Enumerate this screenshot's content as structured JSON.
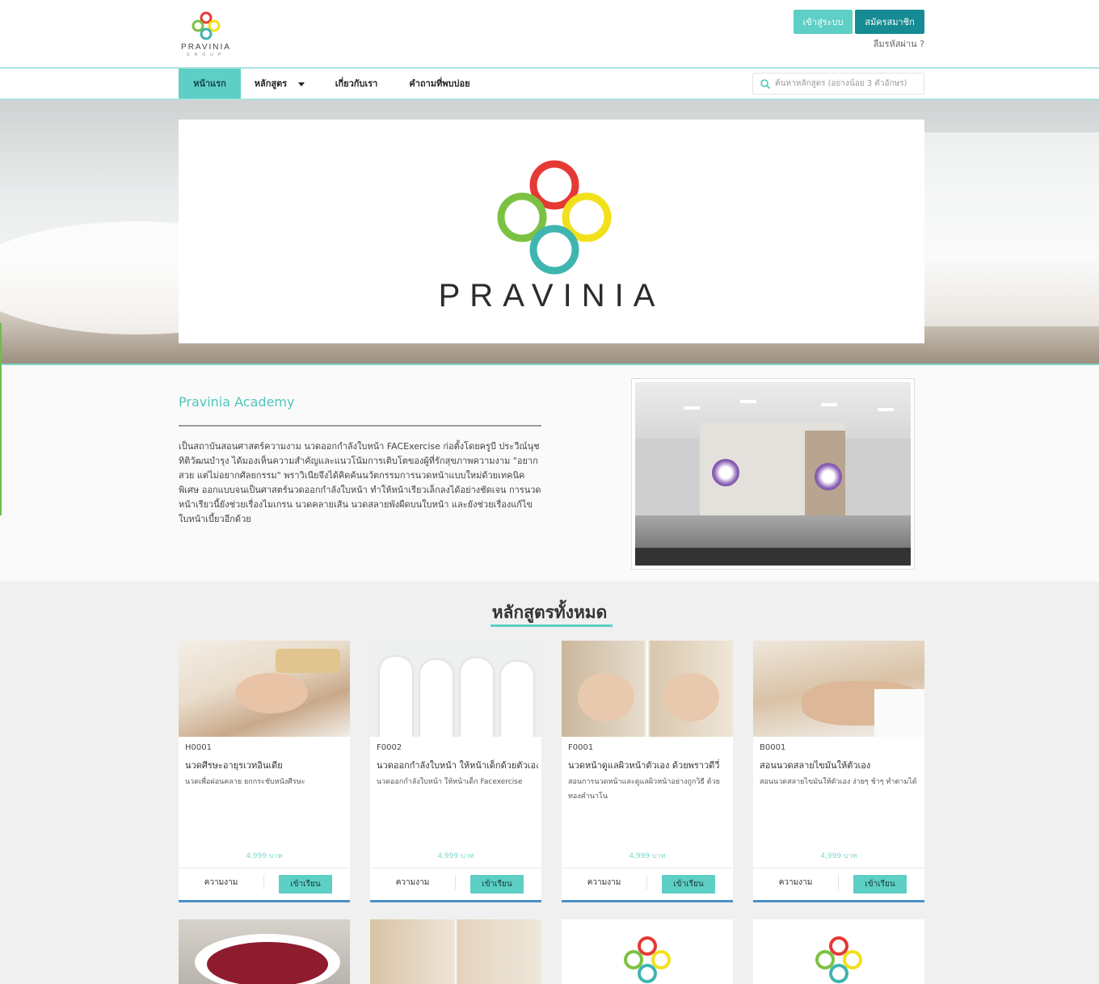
{
  "brand": {
    "logo_text": "PRAVINIA",
    "logo_sub": "GROUP",
    "hero_text": "PRAVINIA",
    "colors": {
      "red": "#e53935",
      "yellow": "#f2e01b",
      "green": "#7cc242",
      "teal": "#3fb5b0"
    }
  },
  "header": {
    "login_label": "เข้าสู่ระบบ",
    "register_label": "สมัครสมาชิก",
    "forgot_label": "ลืมรหัสผ่าน ?"
  },
  "nav": {
    "home": "หน้าแรก",
    "courses": "หลักสูตร",
    "about": "เกี่ยวกับเรา",
    "faq": "คำถามที่พบบ่อย",
    "search_placeholder": "ค้นหาหลักสูตร (อย่างน้อย 3 ตัวอักษร)"
  },
  "academy": {
    "title": "Pravinia Academy",
    "description": "เป็นสถาบันสอนศาสตร์ความงาม นวดออกกำลังใบหน้า FACExercise ก่อตั้งโดยครูบี ประวีณ์นุช ทิติวัฒนบำรุง ได้มองเห็นความสำคัญและแนวโน้มการเติบโตของผู้ที่รักสุขภาพความงาม \"อยากสวย แต่ไม่อยากศัลยกรรม\" พราวิเนียจึงได้คิดค้นนวัตกรรมการนวดหน้าแบบใหม่ด้วยเทคนิคพิเศษ ออกแบบจนเป็นศาสตร์นวดออกกำลังใบหน้า ทำให้หน้าเรียวเล็กลงได้อย่างชัดเจน การนวดหน้าเรียวนี้ยังช่วยเรื่องไมเกรน นวดคลายเส้น นวดสลายพังผืดบนใบหน้า และยังช่วยเรื่องแก้ไขใบหน้าเบี้ยวอีกด้วย"
  },
  "courses": {
    "heading": "หลักสูตรทั้งหมด",
    "items": [
      {
        "code": "H0001",
        "title": "นวดศีรษะอายุรเวทอินเดีย",
        "desc": "นวดเพื่อผ่อนคลาย ยกกระชับหนังศีรษะ",
        "price": "4,999 บาท",
        "category": "ความงาม",
        "action": "เข้าเรียน"
      },
      {
        "code": "F0002",
        "title": "นวดออกกำลังใบหน้า ให้หน้าเด็กด้วยตัวเอง",
        "desc": "นวดออกกำลังใบหน้า ให้หน้าเด็ก Facexercise",
        "price": "4,999 บาท",
        "category": "ความงาม",
        "action": "เข้าเรียน"
      },
      {
        "code": "F0001",
        "title": "นวดหน้าดูแลผิวหน้าตัวเอง ด้วยพราวดีวี่",
        "desc": "สอนการนวดหน้าและดูแลผิวหน้าอย่างถูกวิธี ด้วยทองคำนาโน",
        "price": "4,999 บาท",
        "category": "ความงาม",
        "action": "เข้าเรียน"
      },
      {
        "code": "B0001",
        "title": "สอนนวดสลายไขมันให้ตัวเอง",
        "desc": "สอนนวดสลายไขมันให้ตัวเอง ง่ายๆ ช้าๆ ทำตามได้",
        "price": "4,999 บาท",
        "category": "ความงาม",
        "action": "เข้าเรียน"
      }
    ]
  }
}
